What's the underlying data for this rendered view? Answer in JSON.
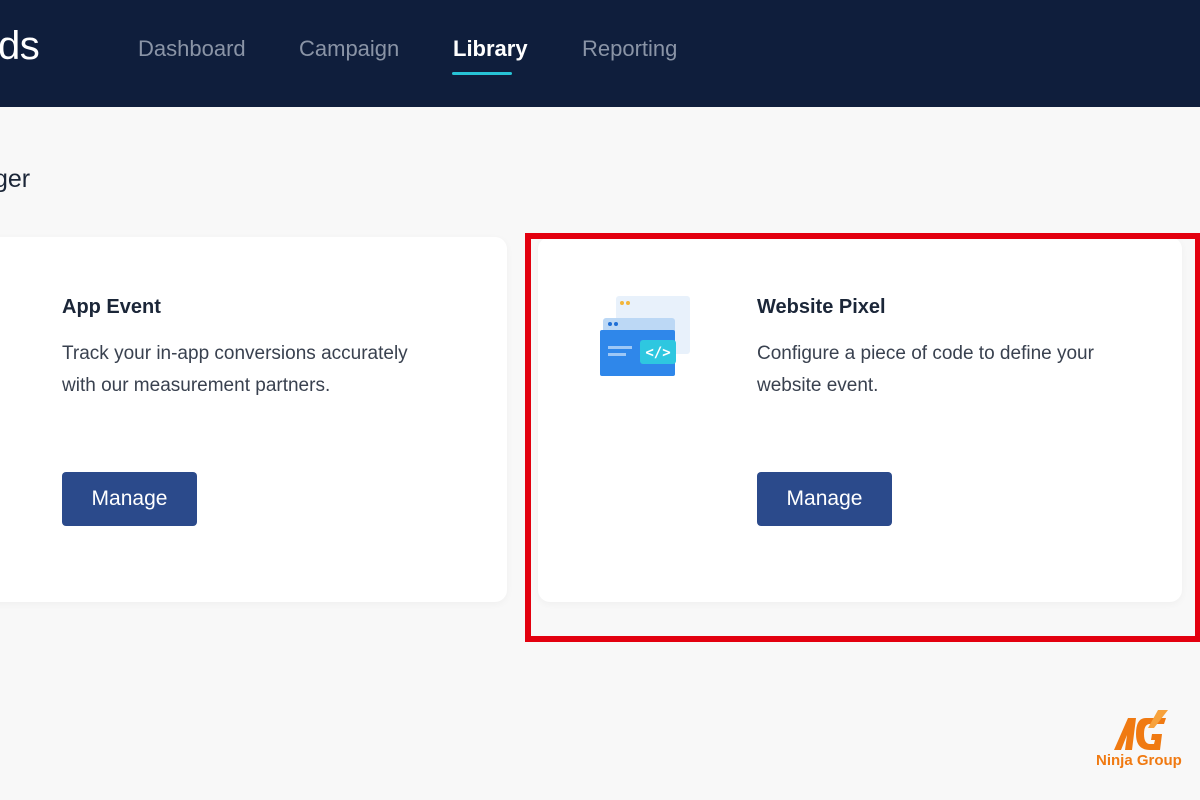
{
  "header": {
    "brand_fragment": "ds",
    "tabs": [
      {
        "label": "Dashboard",
        "active": false
      },
      {
        "label": "Campaign",
        "active": false
      },
      {
        "label": "Library",
        "active": true
      },
      {
        "label": "Reporting",
        "active": false
      }
    ]
  },
  "page": {
    "title_fragment": "ger"
  },
  "cards": [
    {
      "title": "App Event",
      "description": "Track your in-app conversions accurately with our measurement partners.",
      "button_label": "Manage",
      "icon": "app-event-icon"
    },
    {
      "title": "Website Pixel",
      "description": "Configure a piece of code to define your website event.",
      "button_label": "Manage",
      "icon": "website-pixel-icon"
    }
  ],
  "watermark": {
    "text": "Ninja Group"
  },
  "colors": {
    "topbar": "#0f1e3c",
    "accent_underline": "#27c3d6",
    "button": "#2b4a8b",
    "highlight_border": "#e3000f",
    "watermark": "#f07a12"
  }
}
